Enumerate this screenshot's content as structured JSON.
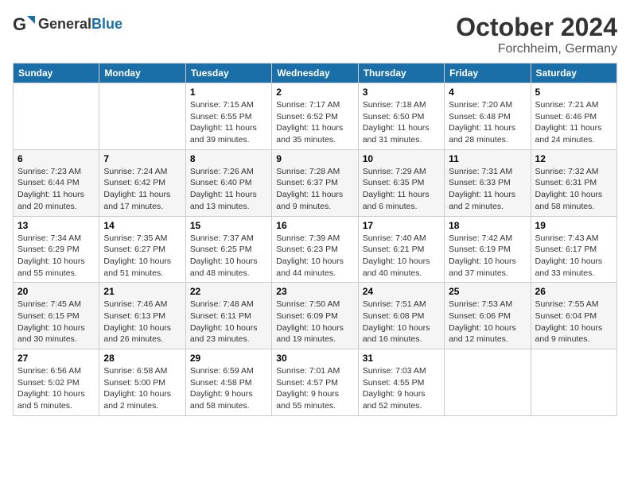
{
  "logo": {
    "text_general": "General",
    "text_blue": "Blue"
  },
  "title": {
    "month": "October 2024",
    "location": "Forchheim, Germany"
  },
  "calendar": {
    "headers": [
      "Sunday",
      "Monday",
      "Tuesday",
      "Wednesday",
      "Thursday",
      "Friday",
      "Saturday"
    ],
    "weeks": [
      [
        {
          "day": "",
          "info": ""
        },
        {
          "day": "",
          "info": ""
        },
        {
          "day": "1",
          "info": "Sunrise: 7:15 AM\nSunset: 6:55 PM\nDaylight: 11 hours and 39 minutes."
        },
        {
          "day": "2",
          "info": "Sunrise: 7:17 AM\nSunset: 6:52 PM\nDaylight: 11 hours and 35 minutes."
        },
        {
          "day": "3",
          "info": "Sunrise: 7:18 AM\nSunset: 6:50 PM\nDaylight: 11 hours and 31 minutes."
        },
        {
          "day": "4",
          "info": "Sunrise: 7:20 AM\nSunset: 6:48 PM\nDaylight: 11 hours and 28 minutes."
        },
        {
          "day": "5",
          "info": "Sunrise: 7:21 AM\nSunset: 6:46 PM\nDaylight: 11 hours and 24 minutes."
        }
      ],
      [
        {
          "day": "6",
          "info": "Sunrise: 7:23 AM\nSunset: 6:44 PM\nDaylight: 11 hours and 20 minutes."
        },
        {
          "day": "7",
          "info": "Sunrise: 7:24 AM\nSunset: 6:42 PM\nDaylight: 11 hours and 17 minutes."
        },
        {
          "day": "8",
          "info": "Sunrise: 7:26 AM\nSunset: 6:40 PM\nDaylight: 11 hours and 13 minutes."
        },
        {
          "day": "9",
          "info": "Sunrise: 7:28 AM\nSunset: 6:37 PM\nDaylight: 11 hours and 9 minutes."
        },
        {
          "day": "10",
          "info": "Sunrise: 7:29 AM\nSunset: 6:35 PM\nDaylight: 11 hours and 6 minutes."
        },
        {
          "day": "11",
          "info": "Sunrise: 7:31 AM\nSunset: 6:33 PM\nDaylight: 11 hours and 2 minutes."
        },
        {
          "day": "12",
          "info": "Sunrise: 7:32 AM\nSunset: 6:31 PM\nDaylight: 10 hours and 58 minutes."
        }
      ],
      [
        {
          "day": "13",
          "info": "Sunrise: 7:34 AM\nSunset: 6:29 PM\nDaylight: 10 hours and 55 minutes."
        },
        {
          "day": "14",
          "info": "Sunrise: 7:35 AM\nSunset: 6:27 PM\nDaylight: 10 hours and 51 minutes."
        },
        {
          "day": "15",
          "info": "Sunrise: 7:37 AM\nSunset: 6:25 PM\nDaylight: 10 hours and 48 minutes."
        },
        {
          "day": "16",
          "info": "Sunrise: 7:39 AM\nSunset: 6:23 PM\nDaylight: 10 hours and 44 minutes."
        },
        {
          "day": "17",
          "info": "Sunrise: 7:40 AM\nSunset: 6:21 PM\nDaylight: 10 hours and 40 minutes."
        },
        {
          "day": "18",
          "info": "Sunrise: 7:42 AM\nSunset: 6:19 PM\nDaylight: 10 hours and 37 minutes."
        },
        {
          "day": "19",
          "info": "Sunrise: 7:43 AM\nSunset: 6:17 PM\nDaylight: 10 hours and 33 minutes."
        }
      ],
      [
        {
          "day": "20",
          "info": "Sunrise: 7:45 AM\nSunset: 6:15 PM\nDaylight: 10 hours and 30 minutes."
        },
        {
          "day": "21",
          "info": "Sunrise: 7:46 AM\nSunset: 6:13 PM\nDaylight: 10 hours and 26 minutes."
        },
        {
          "day": "22",
          "info": "Sunrise: 7:48 AM\nSunset: 6:11 PM\nDaylight: 10 hours and 23 minutes."
        },
        {
          "day": "23",
          "info": "Sunrise: 7:50 AM\nSunset: 6:09 PM\nDaylight: 10 hours and 19 minutes."
        },
        {
          "day": "24",
          "info": "Sunrise: 7:51 AM\nSunset: 6:08 PM\nDaylight: 10 hours and 16 minutes."
        },
        {
          "day": "25",
          "info": "Sunrise: 7:53 AM\nSunset: 6:06 PM\nDaylight: 10 hours and 12 minutes."
        },
        {
          "day": "26",
          "info": "Sunrise: 7:55 AM\nSunset: 6:04 PM\nDaylight: 10 hours and 9 minutes."
        }
      ],
      [
        {
          "day": "27",
          "info": "Sunrise: 6:56 AM\nSunset: 5:02 PM\nDaylight: 10 hours and 5 minutes."
        },
        {
          "day": "28",
          "info": "Sunrise: 6:58 AM\nSunset: 5:00 PM\nDaylight: 10 hours and 2 minutes."
        },
        {
          "day": "29",
          "info": "Sunrise: 6:59 AM\nSunset: 4:58 PM\nDaylight: 9 hours and 58 minutes."
        },
        {
          "day": "30",
          "info": "Sunrise: 7:01 AM\nSunset: 4:57 PM\nDaylight: 9 hours and 55 minutes."
        },
        {
          "day": "31",
          "info": "Sunrise: 7:03 AM\nSunset: 4:55 PM\nDaylight: 9 hours and 52 minutes."
        },
        {
          "day": "",
          "info": ""
        },
        {
          "day": "",
          "info": ""
        }
      ]
    ]
  }
}
